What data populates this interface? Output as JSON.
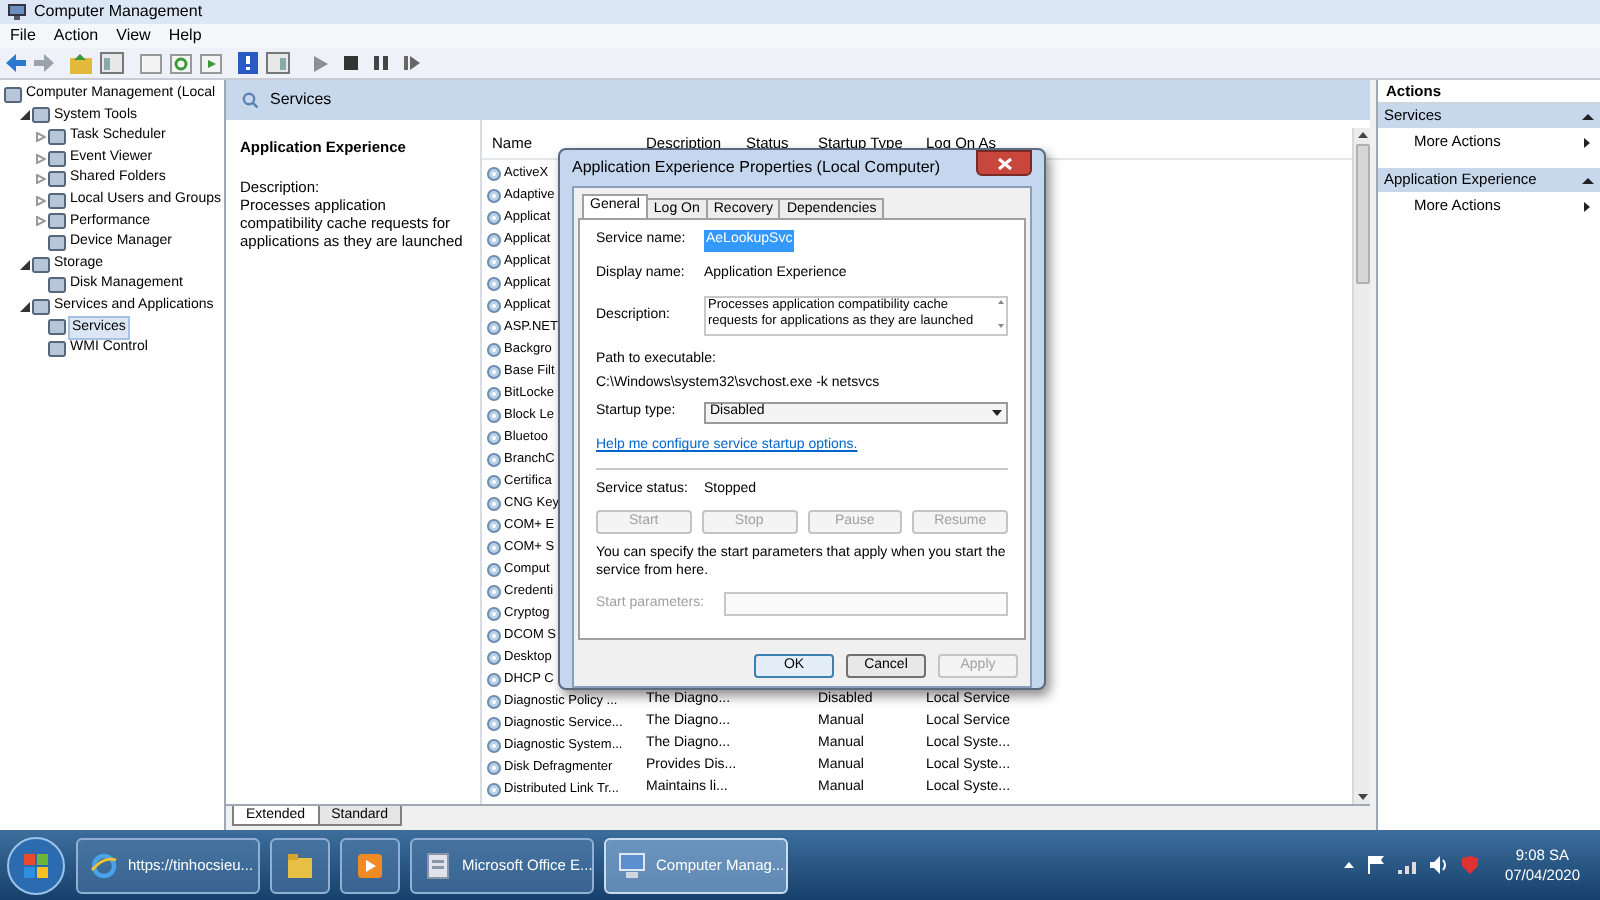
{
  "window": {
    "title": "Computer Management"
  },
  "menu": [
    "File",
    "Action",
    "View",
    "Help"
  ],
  "tree": [
    {
      "label": "Computer Management (Local",
      "selected": false,
      "children": [
        {
          "label": "System Tools",
          "expanded": true,
          "selected": false,
          "children": [
            {
              "label": "Task Scheduler",
              "expanded": false,
              "selected": false
            },
            {
              "label": "Event Viewer",
              "expanded": false,
              "selected": false
            },
            {
              "label": "Shared Folders",
              "expanded": false,
              "selected": false
            },
            {
              "label": "Local Users and Groups",
              "expanded": false,
              "selected": false
            },
            {
              "label": "Performance",
              "expanded": false,
              "selected": false
            },
            {
              "label": "Device Manager",
              "selected": false
            }
          ]
        },
        {
          "label": "Storage",
          "expanded": true,
          "selected": false,
          "children": [
            {
              "label": "Disk Management",
              "selected": false
            }
          ]
        },
        {
          "label": "Services and Applications",
          "expanded": true,
          "selected": false,
          "children": [
            {
              "label": "Services",
              "selected": true
            },
            {
              "label": "WMI Control",
              "selected": false
            }
          ]
        }
      ]
    }
  ],
  "services_header": "Services",
  "detail": {
    "title": "Application Experience",
    "description_label": "Description:",
    "description": "Processes application compatibility cache requests for applications as they are launched"
  },
  "columns": [
    "Name",
    "Description",
    "Status",
    "Startup Type",
    "Log On As"
  ],
  "rows": [
    {
      "name": "ActiveX"
    },
    {
      "name": "Adaptive"
    },
    {
      "name": "Applicat"
    },
    {
      "name": "Applicat"
    },
    {
      "name": "Applicat"
    },
    {
      "name": "Applicat"
    },
    {
      "name": "Applicat"
    },
    {
      "name": "ASP.NET"
    },
    {
      "name": "Backgro"
    },
    {
      "name": "Base Filt"
    },
    {
      "name": "BitLocke"
    },
    {
      "name": "Block Le"
    },
    {
      "name": "Bluetoo"
    },
    {
      "name": "BranchC"
    },
    {
      "name": "Certifica"
    },
    {
      "name": "CNG Key"
    },
    {
      "name": "COM+ E"
    },
    {
      "name": "COM+ S"
    },
    {
      "name": "Comput"
    },
    {
      "name": "Credenti"
    },
    {
      "name": "Cryptog"
    },
    {
      "name": "DCOM S"
    },
    {
      "name": "Desktop"
    },
    {
      "name": "DHCP C"
    },
    {
      "name": "Diagnostic Policy ...",
      "description": "The Diagno...",
      "startup_type": "Disabled",
      "log_on_as": "Local Service"
    },
    {
      "name": "Diagnostic Service...",
      "description": "The Diagno...",
      "startup_type": "Manual",
      "log_on_as": "Local Service"
    },
    {
      "name": "Diagnostic System...",
      "description": "The Diagno...",
      "startup_type": "Manual",
      "log_on_as": "Local Syste..."
    },
    {
      "name": "Disk Defragmenter",
      "description": "Provides Dis...",
      "startup_type": "Manual",
      "log_on_as": "Local Syste..."
    },
    {
      "name": "Distributed Link Tr...",
      "description": "Maintains li...",
      "startup_type": "Manual",
      "log_on_as": "Local Syste..."
    }
  ],
  "view_tabs": [
    {
      "label": "Extended",
      "selected": true
    },
    {
      "label": "Standard",
      "selected": false
    }
  ],
  "actions": {
    "title": "Actions",
    "groups": [
      {
        "label": "Services",
        "items": [
          "More Actions"
        ]
      },
      {
        "label": "Application Experience",
        "items": [
          "More Actions"
        ]
      }
    ]
  },
  "dialog": {
    "title": "Application Experience Properties (Local Computer)",
    "tabs": [
      {
        "label": "General",
        "selected": true
      },
      {
        "label": "Log On",
        "selected": false
      },
      {
        "label": "Recovery",
        "selected": false
      },
      {
        "label": "Dependencies",
        "selected": false
      }
    ],
    "service_name": {
      "label": "Service name:",
      "value": "AeLookupSvc",
      "highlighted": true
    },
    "display_name": {
      "label": "Display name:",
      "value": "Application Experience"
    },
    "description": {
      "label": "Description:",
      "value": "Processes application compatibility cache requests for applications as they are launched"
    },
    "path": {
      "label": "Path to executable:",
      "value": "C:\\Windows\\system32\\svchost.exe -k netsvcs"
    },
    "startup_type": {
      "label": "Startup type:",
      "value": "Disabled"
    },
    "help_link": "Help me configure service startup options.",
    "service_status": {
      "label": "Service status:",
      "value": "Stopped"
    },
    "control_buttons": [
      {
        "label": "Start",
        "disabled": true
      },
      {
        "label": "Stop",
        "disabled": true
      },
      {
        "label": "Pause",
        "disabled": true
      },
      {
        "label": "Resume",
        "disabled": true
      }
    ],
    "hint": "You can specify the start parameters that apply when you start the service from here.",
    "start_parameters": {
      "label": "Start parameters:",
      "disabled": true
    },
    "buttons": [
      {
        "label": "OK",
        "disabled": false
      },
      {
        "label": "Cancel",
        "disabled": false
      },
      {
        "label": "Apply",
        "disabled": true
      }
    ]
  },
  "taskbar": {
    "items": [
      {
        "kind": "browser",
        "label": "https://tinhocsieu...",
        "selected": false
      },
      {
        "kind": "folder",
        "selected": false
      },
      {
        "kind": "media",
        "selected": false
      },
      {
        "kind": "office",
        "label": "Microsoft Office E...",
        "selected": false
      },
      {
        "kind": "computer",
        "label": "Computer Manag...",
        "selected": true
      }
    ],
    "time": "9:08 SA",
    "date": "07/04/2020"
  }
}
